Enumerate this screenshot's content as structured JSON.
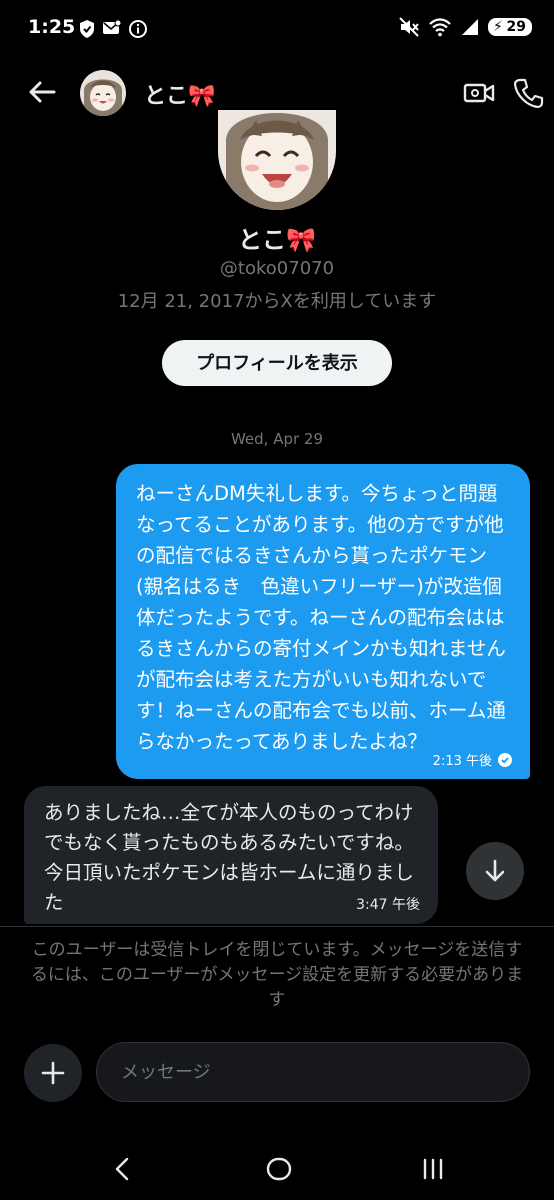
{
  "status_bar": {
    "time": "1:25",
    "battery": "29",
    "icons": [
      "shield-icon",
      "mail-notification-icon",
      "info-icon",
      "mute-icon",
      "wifi-icon",
      "signal-icon",
      "battery-charging-icon"
    ]
  },
  "header": {
    "name": "とこ🎀",
    "icons": [
      "back-arrow-icon",
      "video-call-icon",
      "phone-icon"
    ]
  },
  "profile": {
    "name": "とこ🎀",
    "handle": "@toko07070",
    "joined": "12月 21, 2017からXを利用しています",
    "view_profile_label": "プロフィールを表示"
  },
  "conversation": {
    "date_separator": "Wed, Apr 29",
    "messages": [
      {
        "direction": "outgoing",
        "text": "ねーさんDM失礼します。今ちょっと問題なってることがあります。他の方ですが他の配信ではるきさんから貰ったポケモン(親名はるき　色違いフリーザー)が改造個体だったようです。ねーさんの配布会ははるきさんからの寄付メインかも知れませんが配布会は考えた方がいいも知れないです！ねーさんの配布会でも以前、ホーム通らなかったってありましたよね？",
        "time": "2:13 午後",
        "status": "read"
      },
      {
        "direction": "incoming",
        "text": "ありましたね…全てが本人のものってわけでもなく貰ったものもあるみたいですね。今日頂いたポケモンは皆ホームに通りました",
        "time": "3:47 午後"
      }
    ],
    "closed_notice": "このユーザーは受信トレイを閉じています。メッセージを送信するには、このユーザーがメッセージ設定を更新する必要があります"
  },
  "composer": {
    "placeholder": "メッセージ"
  },
  "colors": {
    "background": "#000000",
    "outgoing_bubble": "#1d9bf0",
    "incoming_bubble": "#202327",
    "secondary_text": "#71767b"
  }
}
